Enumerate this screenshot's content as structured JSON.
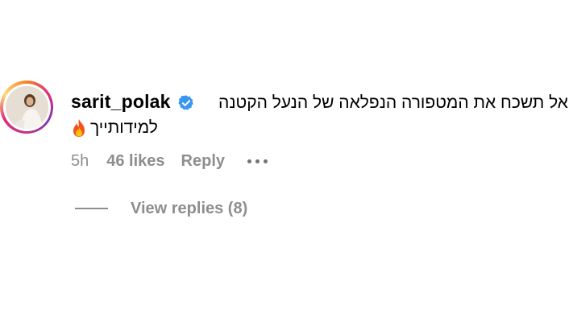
{
  "comment": {
    "username": "sarit_polak",
    "verified_icon": "verified-badge-icon",
    "text_line1": "אל תשכח את המטפורה הנפלאה של הנעל הקטנה",
    "text_line2": "למידותייך",
    "emoji": "fire-emoji"
  },
  "meta": {
    "time": "5h",
    "likes": "46 likes",
    "reply_label": "Reply",
    "more_icon": "more-options-icon"
  },
  "replies": {
    "label": "View replies (8)"
  },
  "colors": {
    "secondary_text": "#8e8e8e",
    "verified_blue": "#3897f0",
    "ring_gradient": [
      "#f58529",
      "#dd2a7b",
      "#8134af",
      "#feda77"
    ]
  }
}
